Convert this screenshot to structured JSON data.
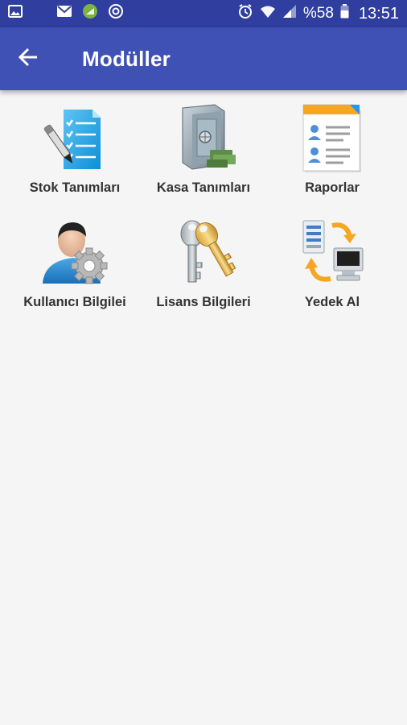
{
  "status_bar": {
    "battery": "%58",
    "time": "13:51"
  },
  "app_bar": {
    "title": "Modüller"
  },
  "modules": [
    {
      "label": "Stok Tanımları",
      "icon": "stock-list-icon"
    },
    {
      "label": "Kasa Tanımları",
      "icon": "safe-icon"
    },
    {
      "label": "Raporlar",
      "icon": "report-icon"
    },
    {
      "label": "Kullanıcı Bilgilei",
      "icon": "user-settings-icon"
    },
    {
      "label": "Lisans Bilgileri",
      "icon": "keys-icon"
    },
    {
      "label": "Yedek Al",
      "icon": "backup-icon"
    }
  ],
  "colors": {
    "status_bar": "#303f9f",
    "app_bar": "#3f51b5",
    "background": "#f5f5f5"
  }
}
